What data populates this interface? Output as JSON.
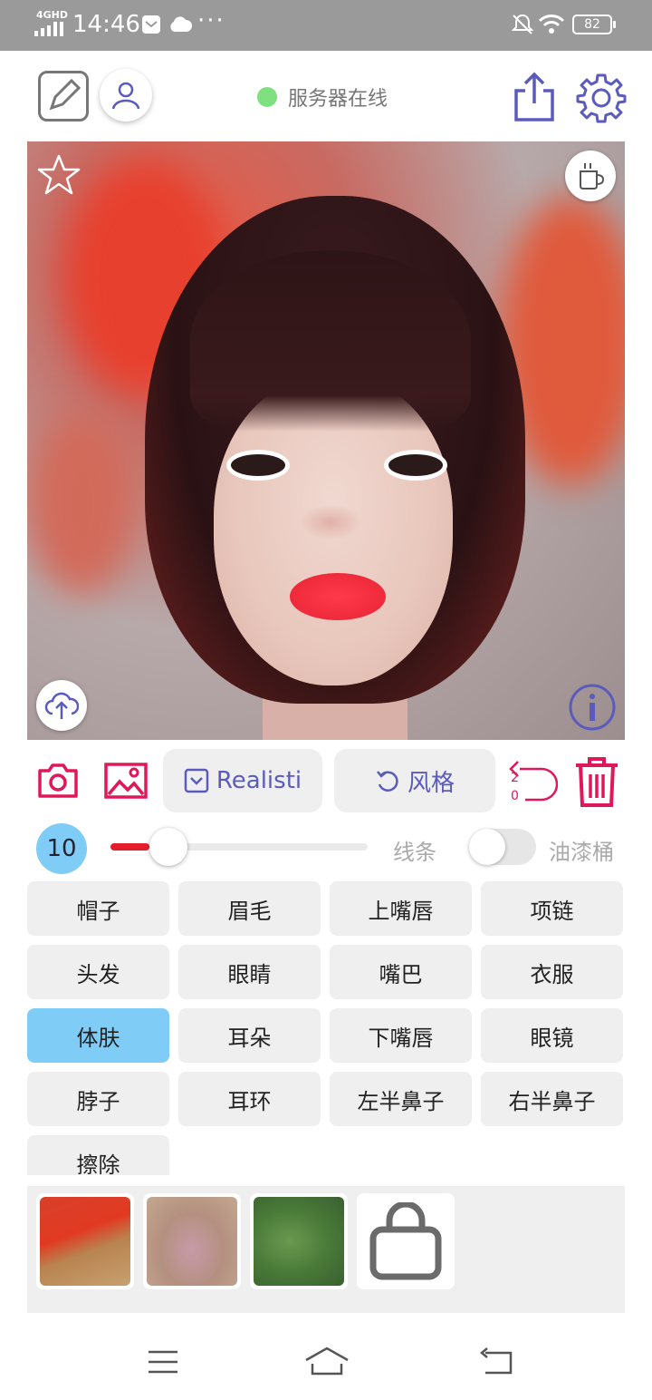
{
  "status_bar": {
    "network": "4GHD",
    "time": "14:46",
    "more": "···",
    "battery": "82"
  },
  "header": {
    "server_status": "服务器在线",
    "server_color": "#7ee07e"
  },
  "toolbar": {
    "model_label": "Realisti",
    "style_label": "风格",
    "undo_count_top": "2",
    "undo_count_bottom": "0",
    "accent": "#e0185a",
    "secondary": "#5b5bbd"
  },
  "brush": {
    "size": "10",
    "size_fraction": 0.15,
    "line_label": "线条",
    "bucket_label": "油漆桶"
  },
  "parts": {
    "items": [
      {
        "label": "帽子"
      },
      {
        "label": "眉毛"
      },
      {
        "label": "上嘴唇"
      },
      {
        "label": "项链"
      },
      {
        "label": "头发"
      },
      {
        "label": "眼睛"
      },
      {
        "label": "嘴巴"
      },
      {
        "label": "衣服"
      },
      {
        "label": "体肤"
      },
      {
        "label": "耳朵"
      },
      {
        "label": "下嘴唇"
      },
      {
        "label": "眼镜"
      },
      {
        "label": "脖子"
      },
      {
        "label": "耳环"
      },
      {
        "label": "左半鼻子"
      },
      {
        "label": "右半鼻子"
      },
      {
        "label": "擦除"
      }
    ],
    "selected": "体肤",
    "selected_color": "#7fcdf7"
  },
  "textures": {
    "items": [
      {
        "name": "red-flower-texture"
      },
      {
        "name": "lace-fabric-texture"
      },
      {
        "name": "green-foliage-texture"
      }
    ],
    "shop_icon": "shopping-bag-icon"
  }
}
